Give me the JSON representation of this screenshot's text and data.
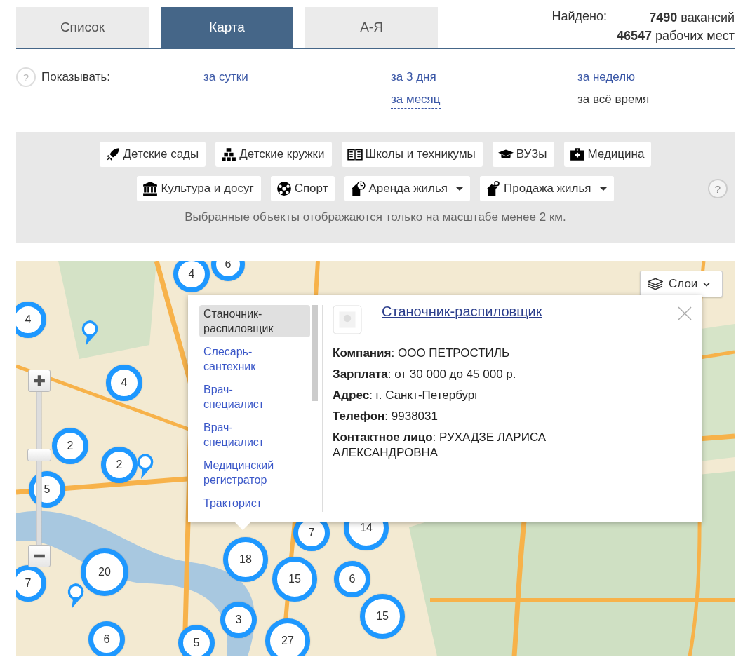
{
  "tabs": [
    {
      "label": "Список",
      "selected": false
    },
    {
      "label": "Карта",
      "selected": true
    },
    {
      "label": "А-Я",
      "selected": false
    }
  ],
  "found": {
    "label": "Найдено:",
    "lines": [
      "**7490** вакансий",
      "**46547** рабочих мест"
    ]
  },
  "period": {
    "help": "?",
    "label": "Показывать:",
    "options": [
      {
        "label": "за сутки",
        "selected": false
      },
      {
        "label": "за 3 дня",
        "selected": false
      },
      {
        "label": "за неделю",
        "selected": false
      },
      {
        "label": "за месяц",
        "selected": false
      },
      {
        "label": "за всё время",
        "selected": true
      }
    ]
  },
  "filters": {
    "items": [
      {
        "label": "Детские сады",
        "kind": "rocket",
        "dropdown": false
      },
      {
        "label": "Детские кружки",
        "kind": "blocks",
        "dropdown": false
      },
      {
        "label": "Школы и техникумы",
        "kind": "book",
        "dropdown": false
      },
      {
        "label": "ВУЗы",
        "kind": "cap",
        "dropdown": false
      },
      {
        "label": "Медицина",
        "kind": "medkit",
        "dropdown": false
      },
      {
        "label": "Культура и досуг",
        "kind": "museum",
        "dropdown": false
      },
      {
        "label": "Спорт",
        "kind": "ball",
        "dropdown": false
      },
      {
        "label": "Аренда жилья",
        "kind": "house-clock",
        "dropdown": true
      },
      {
        "label": "Продажа жилья",
        "kind": "house-ruble",
        "dropdown": true
      }
    ],
    "help": "?",
    "note": "Выбранные объекты отображаются только на масштабе менее 2 км."
  },
  "map": {
    "layers_button": "Слои",
    "zoom": {
      "level": 0.6
    },
    "clusters": [
      {
        "count": "6"
      },
      {
        "count": "4"
      },
      {
        "count": "4"
      },
      {
        "count": "4"
      },
      {
        "count": "2"
      },
      {
        "count": "2"
      },
      {
        "count": "5"
      },
      {
        "count": "7"
      },
      {
        "count": "14"
      },
      {
        "count": "7"
      },
      {
        "count": "20"
      },
      {
        "count": "18"
      },
      {
        "count": "15"
      },
      {
        "count": "6"
      },
      {
        "count": "15"
      },
      {
        "count": "3"
      },
      {
        "count": "6"
      },
      {
        "count": "5"
      },
      {
        "count": "27"
      }
    ],
    "popup": {
      "list": [
        {
          "label": "Станочник-распиловщик",
          "selected": true
        },
        {
          "label": "Слесарь-сантехник",
          "selected": false
        },
        {
          "label": "Врач-специалист",
          "selected": false
        },
        {
          "label": "Врач-специалист",
          "selected": false
        },
        {
          "label": "Медицинский регистратор",
          "selected": false
        },
        {
          "label": "Тракторист",
          "selected": false
        }
      ],
      "title": "Станочник-распиловщик",
      "fields": [
        "**Компания**: ООО ПЕТРОСТИЛЬ",
        "**Зарплата**: от 30 000 до 45 000 р.",
        "**Адрес**: г. Санкт-Петербург",
        "**Телефон**: 9938031",
        "**Контактное лицо**: РУХАДЗЕ ЛАРИСА АЛЕКСАНДРОВНА"
      ]
    }
  }
}
